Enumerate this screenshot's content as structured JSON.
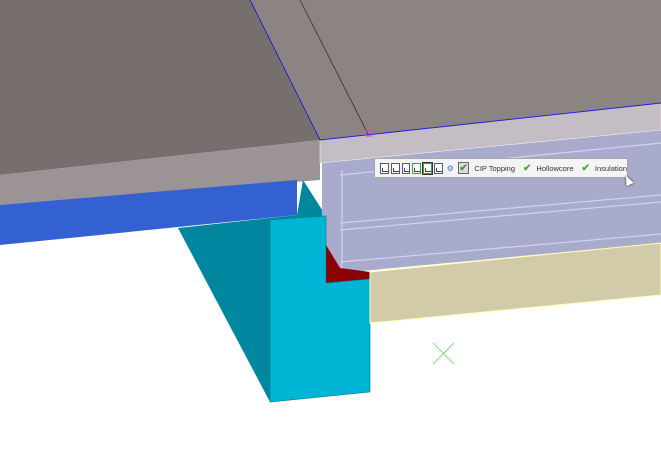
{
  "colors": {
    "slab_top_left": "#776f6e",
    "slab_top_right": "#8c8383",
    "slab_face_left": "#9b9395",
    "slab_face_right": "#c4bdc3",
    "beam": "#3461d2",
    "column_dark": "#0087a0",
    "column_light": "#00b4d4",
    "bearing": "#8b0000",
    "hollowcore": "#a9abcc",
    "insulation": "#d2cba9",
    "edge_line": "#2020e0",
    "marker": "#80e080"
  },
  "toolbar": {
    "icons": [
      "corner-cut-icon",
      "end-cut-icon",
      "edge-cut-icon",
      "layer-cut-icon",
      "layer-select-icon",
      "book-icon",
      "settings-icon"
    ],
    "options": [
      {
        "label": "CIP Topping",
        "checked": true
      },
      {
        "label": "Hollowcore",
        "checked": true
      },
      {
        "label": "Insulation",
        "checked": true
      }
    ]
  }
}
